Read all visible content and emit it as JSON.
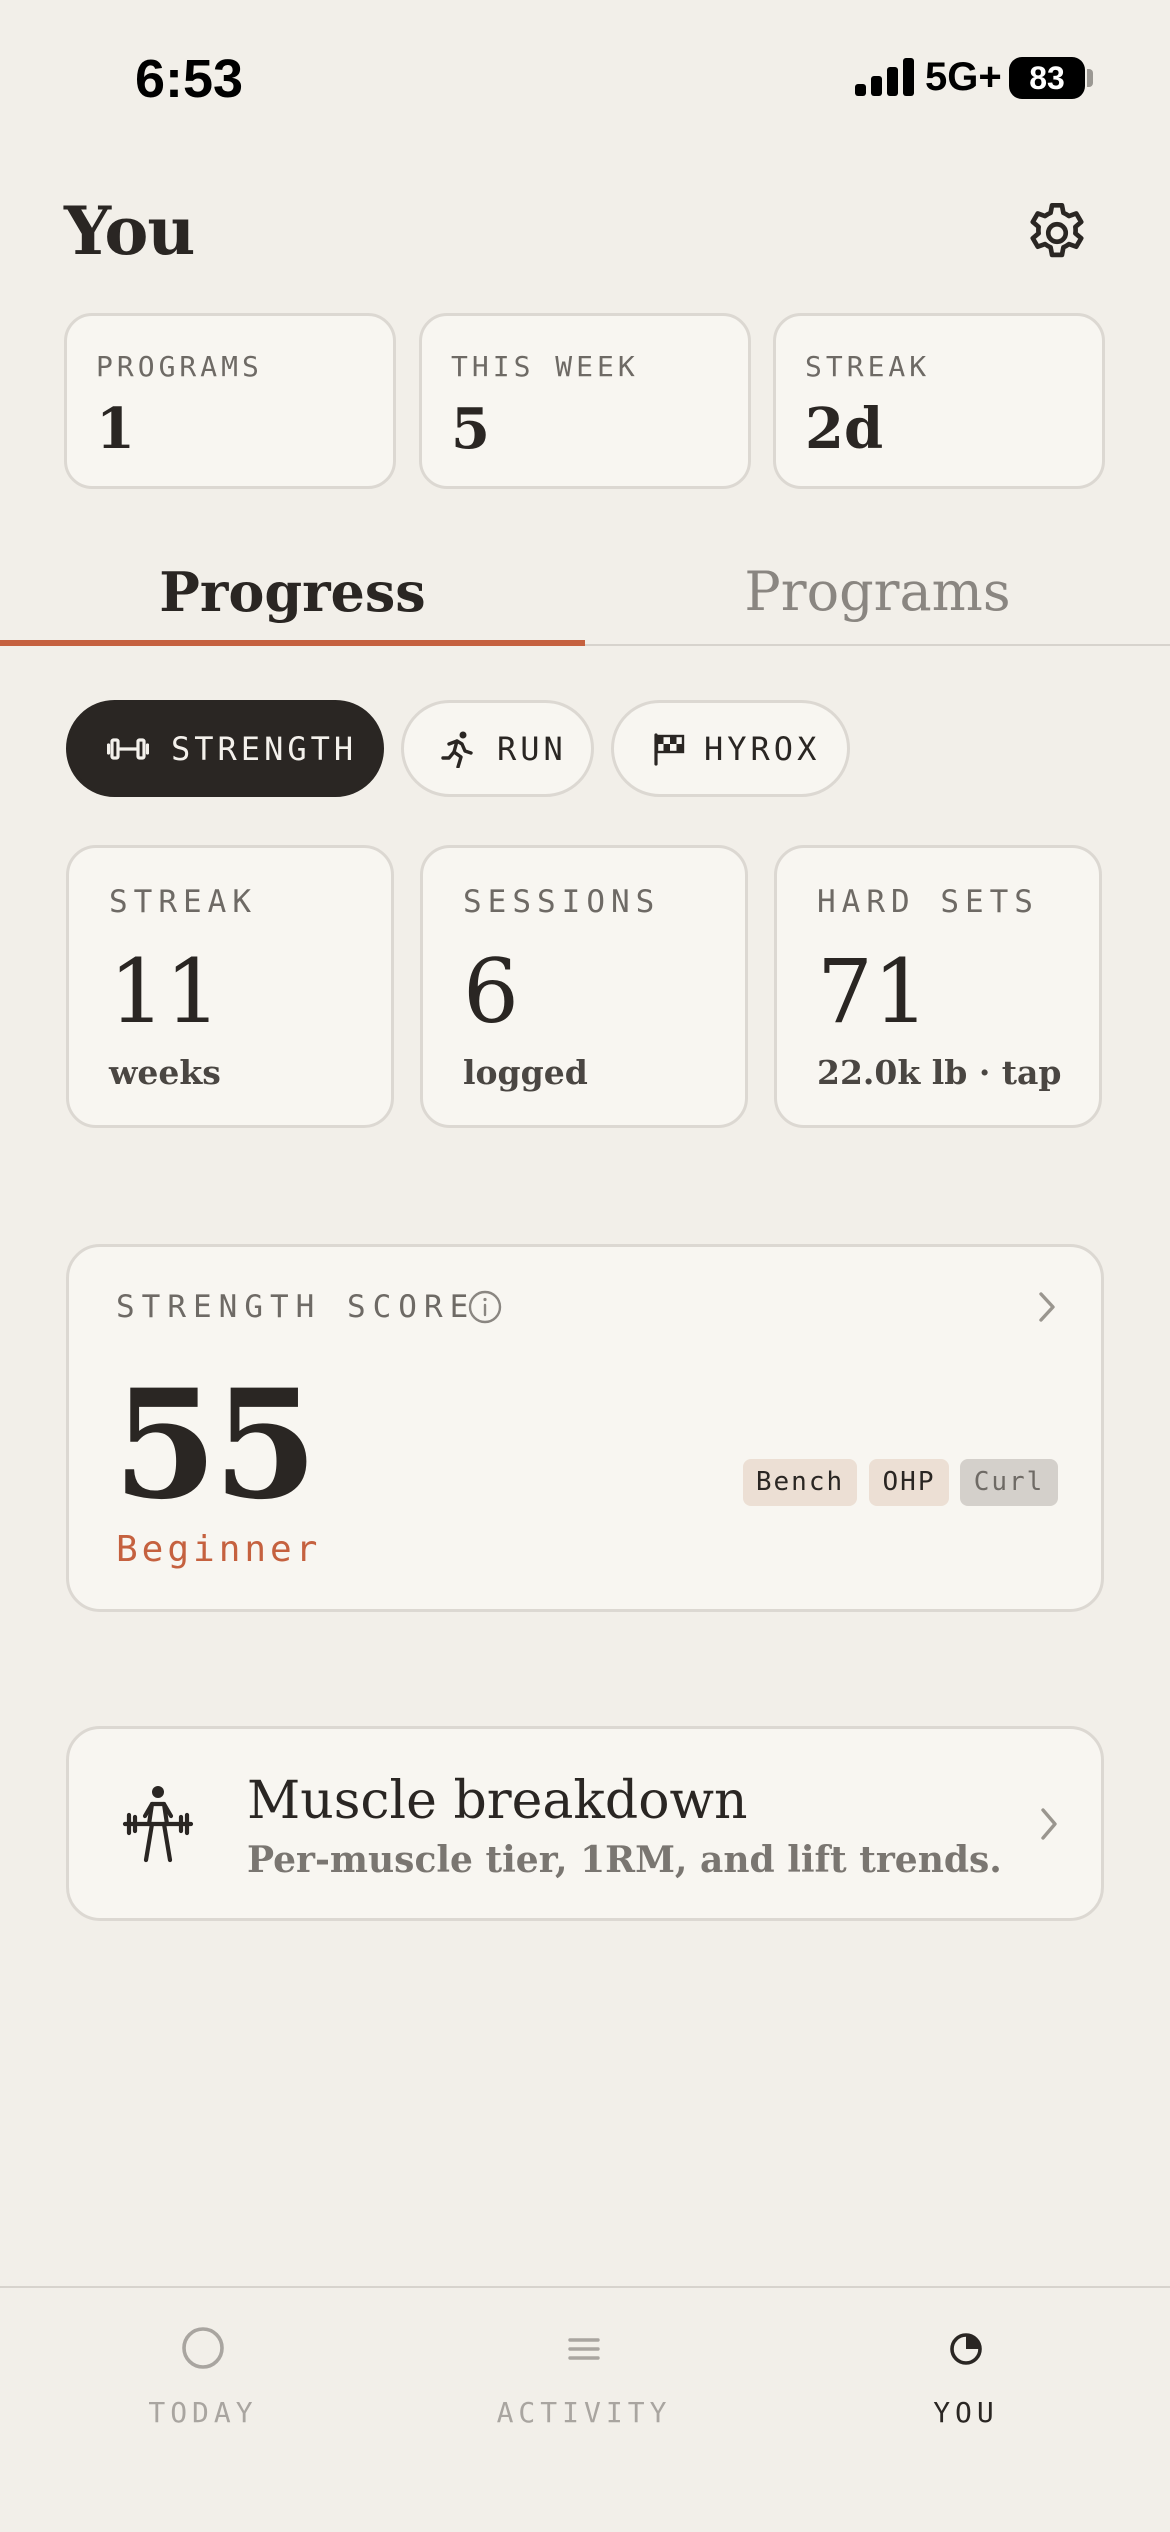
{
  "status_bar": {
    "time": "6:53",
    "network": "5G+",
    "battery": "83"
  },
  "header": {
    "title": "You"
  },
  "top_stats": [
    {
      "label": "PROGRAMS",
      "value": "1"
    },
    {
      "label": "THIS WEEK",
      "value": "5"
    },
    {
      "label": "STREAK",
      "value": "2d"
    }
  ],
  "tabs": [
    {
      "label": "Progress",
      "active": true
    },
    {
      "label": "Programs",
      "active": false
    }
  ],
  "filters": [
    {
      "label": "STRENGTH",
      "icon": "dumbbell-icon",
      "active": true
    },
    {
      "label": "RUN",
      "icon": "runner-icon",
      "active": false
    },
    {
      "label": "HYROX",
      "icon": "checkered-flag-icon",
      "active": false
    }
  ],
  "metrics": [
    {
      "label": "STREAK",
      "value": "11",
      "sub": "weeks"
    },
    {
      "label": "SESSIONS",
      "value": "6",
      "sub": "logged"
    },
    {
      "label": "HARD SETS",
      "value": "71",
      "sub": "22.0k lb · tap"
    }
  ],
  "strength_score": {
    "label": "STRENGTH SCORE",
    "score": "55",
    "tier": "Beginner",
    "lifts": [
      {
        "name": "Bench",
        "state": "on"
      },
      {
        "name": "OHP",
        "state": "on"
      },
      {
        "name": "Curl",
        "state": "off"
      }
    ]
  },
  "muscle_breakdown": {
    "title": "Muscle breakdown",
    "description": "Per-muscle tier, 1RM, and lift trends."
  },
  "bottom_nav": [
    {
      "label": "TODAY",
      "icon": "circle-icon",
      "active": false
    },
    {
      "label": "ACTIVITY",
      "icon": "list-icon",
      "active": false
    },
    {
      "label": "YOU",
      "icon": "pie-chart-icon",
      "active": true
    }
  ],
  "colors": {
    "accent": "#c5613f",
    "ink": "#2a2623",
    "background": "#f2efe9",
    "card": "#f8f6f1"
  }
}
